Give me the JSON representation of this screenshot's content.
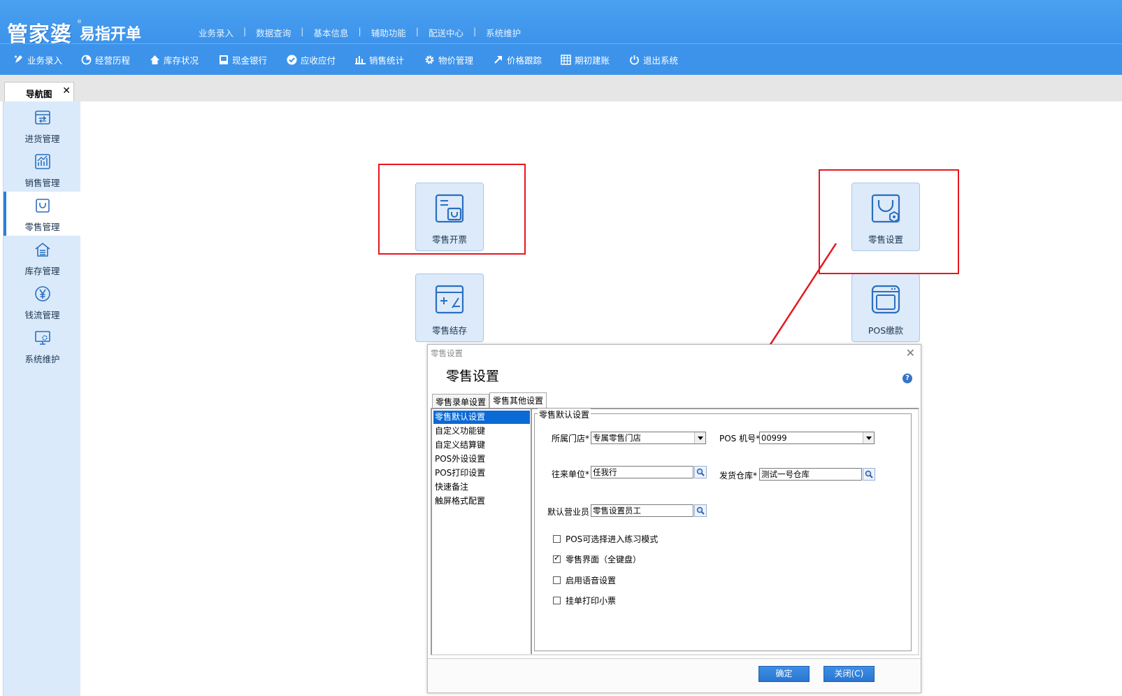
{
  "app": {
    "logo_main": "管家婆",
    "logo_reg": "®",
    "logo_sub": "易指开单"
  },
  "top_menu": [
    "业务录入",
    "数据查询",
    "基本信息",
    "辅助功能",
    "配送中心",
    "系统维护"
  ],
  "top_menu_separator": "|",
  "toolbar": [
    {
      "label": "业务录入",
      "icon": "pen-icon"
    },
    {
      "label": "经营历程",
      "icon": "pie-icon"
    },
    {
      "label": "库存状况",
      "icon": "home-icon"
    },
    {
      "label": "现金银行",
      "icon": "book-icon"
    },
    {
      "label": "应收应付",
      "icon": "check-circle-icon"
    },
    {
      "label": "销售统计",
      "icon": "bar-chart-icon"
    },
    {
      "label": "物价管理",
      "icon": "gear-icon"
    },
    {
      "label": "价格跟踪",
      "icon": "arrow-up-right-icon"
    },
    {
      "label": "期初建账",
      "icon": "calendar-icon"
    },
    {
      "label": "退出系统",
      "icon": "power-icon"
    }
  ],
  "tab": {
    "label": "导航图",
    "close": "✕"
  },
  "sidebar": [
    {
      "label": "进货管理",
      "icon": "purchase-icon",
      "active": false
    },
    {
      "label": "销售管理",
      "icon": "sales-chart-icon",
      "active": false
    },
    {
      "label": "零售管理",
      "icon": "shopping-bag-icon",
      "active": true
    },
    {
      "label": "库存管理",
      "icon": "warehouse-icon",
      "active": false
    },
    {
      "label": "钱流管理",
      "icon": "yen-icon",
      "active": false
    },
    {
      "label": "系统维护",
      "icon": "settings-monitor-icon",
      "active": false
    }
  ],
  "tiles": [
    {
      "label": "零售开票",
      "icon": "retail-invoice-icon"
    },
    {
      "label": "零售设置",
      "icon": "retail-settings-icon"
    },
    {
      "label": "零售结存",
      "icon": "retail-balance-icon"
    },
    {
      "label": "POS缴款",
      "icon": "pos-payment-icon"
    }
  ],
  "dialog": {
    "caption": "零售设置",
    "close": "✕",
    "title": "零售设置",
    "help": "?",
    "tabs": [
      "零售录单设置",
      "零售其他设置"
    ],
    "active_tab": 1,
    "nav": [
      "零售默认设置",
      "自定义功能键",
      "自定义结算键",
      "POS外设设置",
      "POS打印设置",
      "快速备注",
      "触屏格式配置"
    ],
    "nav_selected": 0,
    "group_title": "零售默认设置",
    "fields": {
      "store_label": "所属门店*",
      "store_value": "专属零售门店",
      "pos_label": "POS 机号*",
      "pos_value": "00999",
      "partner_label": "往来单位*",
      "partner_value": "任我行",
      "warehouse_label": "发货仓库*",
      "warehouse_value": "测试一号仓库",
      "clerk_label": "默认营业员",
      "clerk_value": "零售设置员工"
    },
    "checkboxes": [
      {
        "label": "POS可选择进入练习模式",
        "checked": false
      },
      {
        "label": "零售界面（全键盘）",
        "checked": true
      },
      {
        "label": "启用语音设置",
        "checked": false
      },
      {
        "label": "挂单打印小票",
        "checked": false
      }
    ],
    "ok_button": "确定",
    "close_button": "关闭(C)"
  },
  "colors": {
    "header_blue": "#3d93ea",
    "sidebar_bg": "#daeafb",
    "highlight_red": "#e8161f",
    "button_blue": "#2a76d0"
  }
}
